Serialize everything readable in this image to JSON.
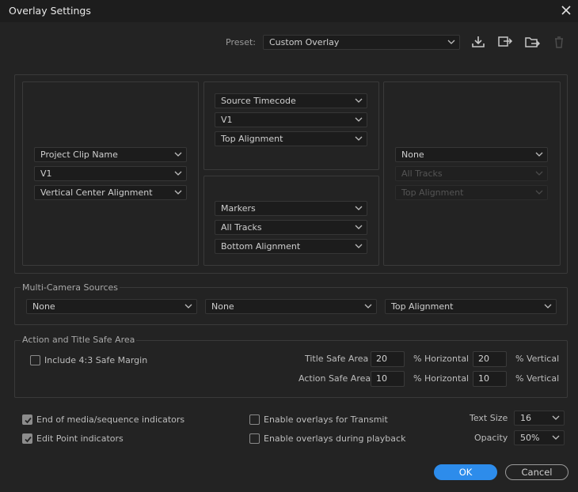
{
  "window": {
    "title": "Overlay Settings"
  },
  "preset": {
    "label": "Preset:",
    "value": "Custom Overlay",
    "icons": [
      "save-preset-icon",
      "import-preset-icon",
      "export-preset-icon",
      "delete-preset-icon"
    ]
  },
  "layout": {
    "left": {
      "source": "Project Clip Name",
      "track": "V1",
      "alignment": "Vertical Center Alignment"
    },
    "top_center": {
      "source": "Source Timecode",
      "track": "V1",
      "alignment": "Top Alignment"
    },
    "bottom_center": {
      "source": "Markers",
      "track": "All Tracks",
      "alignment": "Bottom Alignment"
    },
    "right": {
      "source": "None",
      "track": "All Tracks",
      "alignment": "Top Alignment"
    }
  },
  "multicam": {
    "title": "Multi-Camera Sources",
    "source": "None",
    "track": "None",
    "alignment": "Top Alignment"
  },
  "safe_area": {
    "title": "Action and Title Safe Area",
    "include_43_label": "Include 4:3 Safe Margin",
    "include_43_checked": false,
    "title_safe": {
      "label": "Title Safe Area",
      "horizontal": "20",
      "vertical": "20"
    },
    "action_safe": {
      "label": "Action Safe Area",
      "horizontal": "10",
      "vertical": "10"
    },
    "horizontal_unit": "% Horizontal",
    "vertical_unit": "% Vertical"
  },
  "options": {
    "end_indicators": {
      "label": "End of media/sequence indicators",
      "checked": true
    },
    "edit_point": {
      "label": "Edit Point indicators",
      "checked": true
    },
    "transmit": {
      "label": "Enable overlays for Transmit",
      "checked": false
    },
    "playback": {
      "label": "Enable overlays during playback",
      "checked": false
    },
    "text_size": {
      "label": "Text Size",
      "value": "16"
    },
    "opacity": {
      "label": "Opacity",
      "value": "50%"
    }
  },
  "buttons": {
    "ok": "OK",
    "cancel": "Cancel"
  },
  "colors": {
    "accent": "#2d8ceb",
    "background": "#232323",
    "titlebar": "#1d1d1d"
  }
}
